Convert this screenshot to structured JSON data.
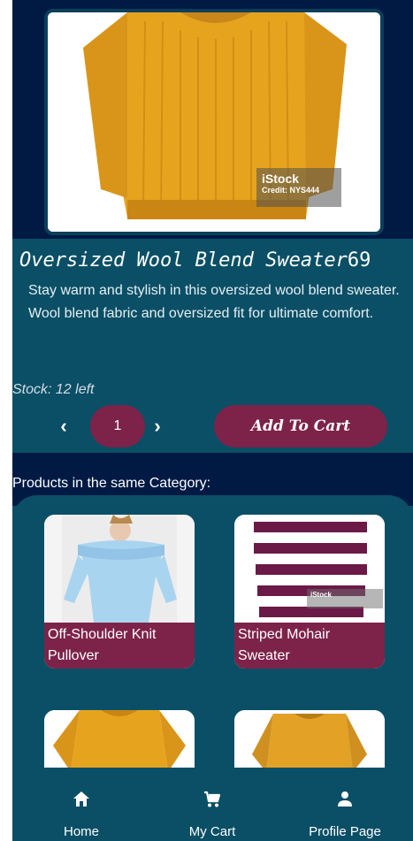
{
  "product": {
    "title": "Oversized Wool Blend Sweater",
    "price": "69",
    "description": "Stay warm and stylish in this oversized wool blend sweater. Wool blend fabric and oversized fit for ultimate comfort.",
    "stock_text": "Stock: 12 left",
    "quantity": "1",
    "add_to_cart_label": "Add To Cart",
    "image_watermark": {
      "brand": "iStock",
      "credit": "Credit: NYS444"
    }
  },
  "controls": {
    "decrement_icon": "chevron-left-icon",
    "increment_icon": "chevron-right-icon",
    "decrement_glyph": "‹",
    "increment_glyph": "›"
  },
  "related": {
    "heading": "Products in the same Category:",
    "items": [
      {
        "name": "Off-Shoulder Knit Pullover"
      },
      {
        "name": "Striped Mohair Sweater"
      }
    ],
    "watermark_brand": "iStock"
  },
  "nav": {
    "items": [
      {
        "label": "Home",
        "icon": "home-icon"
      },
      {
        "label": "My Cart",
        "icon": "cart-icon"
      },
      {
        "label": "Profile Page",
        "icon": "person-icon"
      }
    ]
  },
  "colors": {
    "navy": "#001a44",
    "teal": "#0a4f66",
    "accent": "#7d2349",
    "sweater_mustard": "#e6a41e",
    "sky_blue": "#a9d4f0",
    "plum": "#6b1a48"
  }
}
